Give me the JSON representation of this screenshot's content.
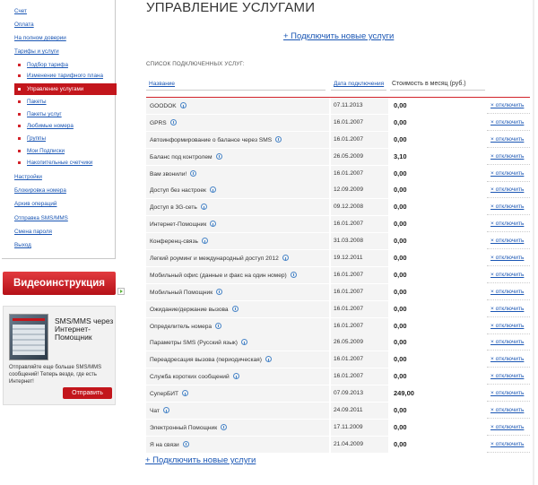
{
  "sidebar": {
    "menu": [
      {
        "label": "Счет",
        "level": 0
      },
      {
        "label": "Оплата",
        "level": 0
      },
      {
        "label": "На полном доверии",
        "level": 0
      },
      {
        "label": "Тарифы и услуги",
        "level": 0
      },
      {
        "label": "Подбор тарифа",
        "level": 1
      },
      {
        "label": "Изменение тарифного плана",
        "level": 1
      },
      {
        "label": "Управление услугами",
        "level": 1,
        "active": true
      },
      {
        "label": "Пакеты",
        "level": 1
      },
      {
        "label": "Пакеты услуг",
        "level": 1
      },
      {
        "label": "Любимые номера",
        "level": 1
      },
      {
        "label": "Группы",
        "level": 1
      },
      {
        "label": "Мои Подписки",
        "level": 1
      },
      {
        "label": "Накопительные счетчики",
        "level": 1
      },
      {
        "label": "Настройки",
        "level": 0
      },
      {
        "label": "Блокировка номера",
        "level": 0
      },
      {
        "label": "Архив операций",
        "level": 0
      },
      {
        "label": "Отправка SMS/MMS",
        "level": 0
      },
      {
        "label": "Смена пароля",
        "level": 0
      },
      {
        "label": "Выход",
        "level": 0
      }
    ],
    "video_button": "Видеоинструкция",
    "promo": {
      "title": "SMS/MMS через Интернет-Помощник",
      "text": "Отправляйте еще больше SMS/MMS сообщений! Теперь везде, где есть Интернет!",
      "button": "Отправить"
    }
  },
  "main": {
    "title": "УПРАВЛЕНИЕ УСЛУГАМИ",
    "add_link_top": "+ Подключить новые услуги",
    "add_link_bottom": "+ Подключить новые услуги",
    "list_caption": "СПИСОК ПОДКЛЮЧЕННЫХ УСЛУГ:",
    "columns": {
      "name": "Название",
      "date": "Дата подключения",
      "price": "Стоимость в месяц (руб.)"
    },
    "action_label": "× отключить",
    "services": [
      {
        "name": "GOODOK",
        "date": "07.11.2013",
        "price": "0,00"
      },
      {
        "name": "GPRS",
        "date": "16.01.2007",
        "price": "0,00"
      },
      {
        "name": "Автоинформирование о балансе через SMS",
        "date": "16.01.2007",
        "price": "0,00"
      },
      {
        "name": "Баланс под контролем",
        "date": "26.05.2009",
        "price": "3,10"
      },
      {
        "name": "Вам звонили!",
        "date": "16.01.2007",
        "price": "0,00"
      },
      {
        "name": "Доступ без настроек",
        "date": "12.09.2009",
        "price": "0,00"
      },
      {
        "name": "Доступ в 3G-сеть",
        "date": "09.12.2008",
        "price": "0,00"
      },
      {
        "name": "Интернет-Помощник",
        "date": "16.01.2007",
        "price": "0,00"
      },
      {
        "name": "Конференц-связь",
        "date": "31.03.2008",
        "price": "0,00"
      },
      {
        "name": "Легкий роуминг и международный доступ 2012",
        "date": "19.12.2011",
        "price": "0,00"
      },
      {
        "name": "Мобильный офис (данные и факс на один номер)",
        "date": "16.01.2007",
        "price": "0,00"
      },
      {
        "name": "Мобильный Помощник",
        "date": "16.01.2007",
        "price": "0,00"
      },
      {
        "name": "Ожидание/держание вызова",
        "date": "16.01.2007",
        "price": "0,00"
      },
      {
        "name": "Определитель номера",
        "date": "16.01.2007",
        "price": "0,00"
      },
      {
        "name": "Параметры SMS (Русский язык)",
        "date": "26.05.2009",
        "price": "0,00"
      },
      {
        "name": "Переадресация вызова (периодическая)",
        "date": "16.01.2007",
        "price": "0,00"
      },
      {
        "name": "Служба коротких сообщений",
        "date": "16.01.2007",
        "price": "0,00"
      },
      {
        "name": "СуперБИТ",
        "date": "07.09.2013",
        "price": "249,00"
      },
      {
        "name": "Чат",
        "date": "24.09.2011",
        "price": "0,00"
      },
      {
        "name": "Электронный Помощник",
        "date": "17.11.2009",
        "price": "0,00"
      },
      {
        "name": "Я на связи",
        "date": "21.04.2009",
        "price": "0,00"
      }
    ]
  },
  "colors": {
    "accent_red": "#c3161c",
    "link_blue": "#1a56b4"
  }
}
